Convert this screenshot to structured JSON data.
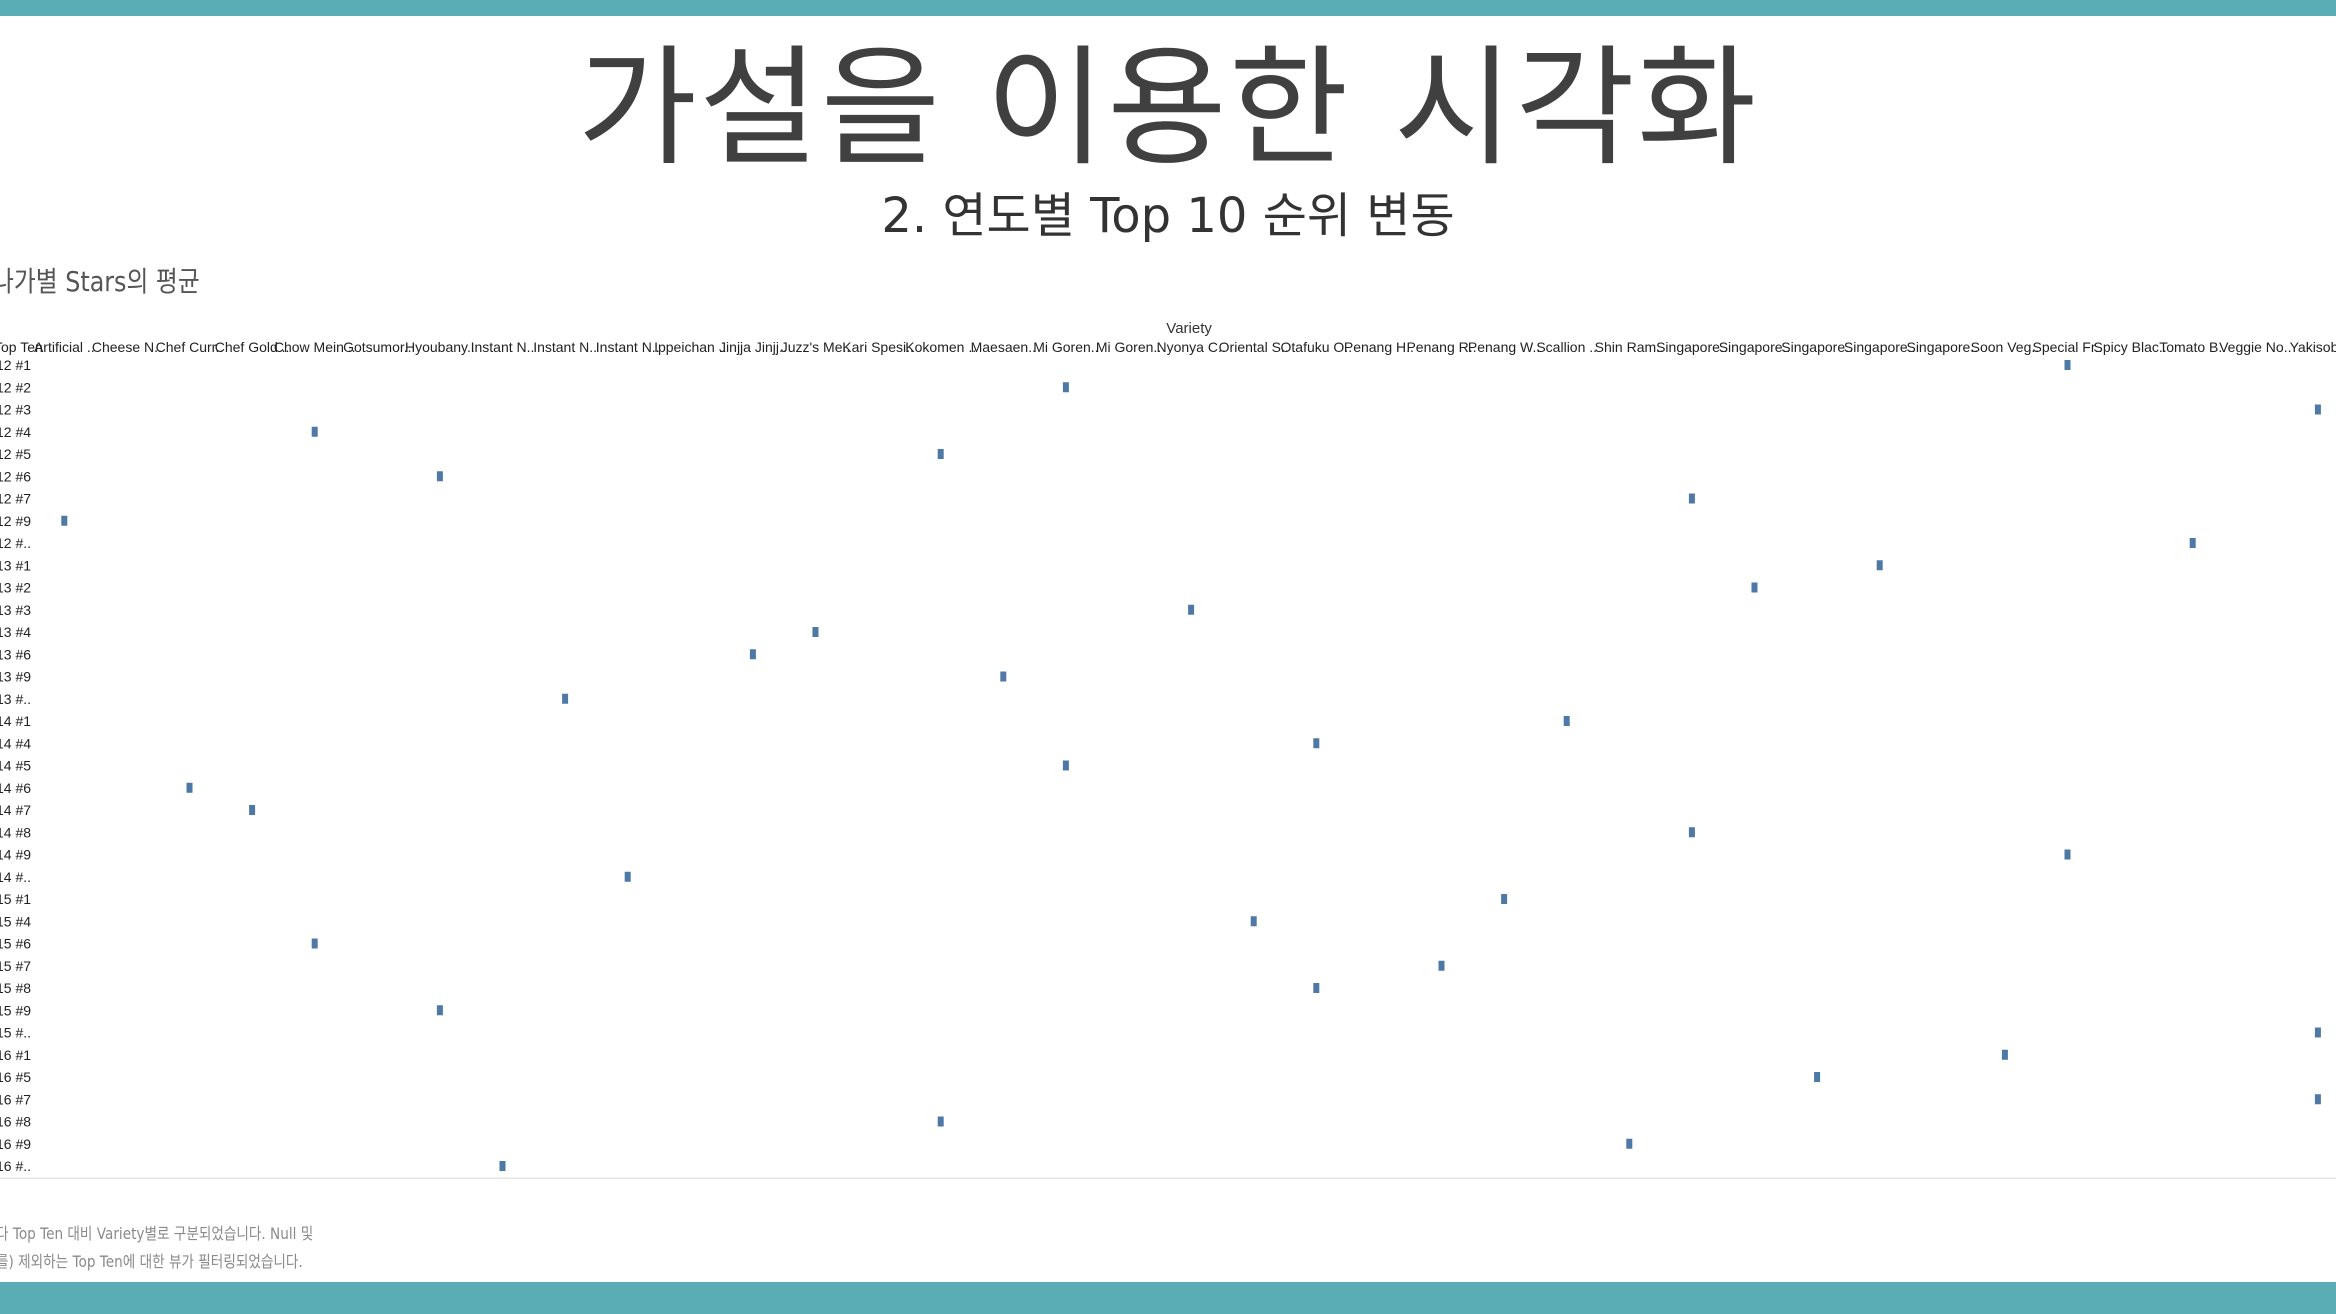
{
  "slide": {
    "title": "가설을 이용한 시각화",
    "subtitle": "2. 연도별 Top 10 순위 변동",
    "sheet_title": "나가별 Stars의 평균",
    "footnote_lines": [
      "다 Top Ten 대비 Variety별로 구분되었습니다. Null 및",
      "를) 제외하는 Top Ten에 대한 뷰가 필터링되었습니다."
    ]
  },
  "colors": {
    "accent_bar": "#5aadb5",
    "mark": "#4e79a7",
    "text": "#404040"
  },
  "chart_data": {
    "type": "scatter",
    "column_header": "Variety",
    "row_header": "Top Ten",
    "columns": [
      "Artificial ..",
      "Cheese N..",
      "Chef Curr..",
      "Chef Gold ..",
      "Chow Mein ..",
      "Gotsumor..",
      "Hyoubany..",
      "Instant N..",
      "Instant N..",
      "Instant N..",
      "Ippeichan ..",
      "Jinjja Jinjj..",
      "Juzz's Me..",
      "Kari Spesi..",
      "Kokomen ..",
      "Maesaen..",
      "Mi Goren..",
      "Mi Goren..",
      "Nyonya C..",
      "Oriental S..",
      "Otafuku O..",
      "Penang H..",
      "Penang R..",
      "Penang W..",
      "Scallion ..",
      "Shin Ram..",
      "Singapore..",
      "Singapore..",
      "Singapore..",
      "Singapore..",
      "Singapore..",
      "Soon Veg..",
      "Special Fr..",
      "Spicy Blac..",
      "Tomato B..",
      "Veggie No..",
      "Yakisoba"
    ],
    "rows": [
      "12 #1",
      "12 #2",
      "12 #3",
      "12 #4",
      "12 #5",
      "12 #6",
      "12 #7",
      "12 #9",
      "12 #..",
      "13 #1",
      "13 #2",
      "13 #3",
      "13 #4",
      "13 #6",
      "13 #9",
      "13 #..",
      "14 #1",
      "14 #4",
      "14 #5",
      "14 #6",
      "14 #7",
      "14 #8",
      "14 #9",
      "14 #..",
      "15 #1",
      "15 #4",
      "15 #6",
      "15 #7",
      "15 #8",
      "15 #9",
      "15 #..",
      "16 #1",
      "16 #5",
      "16 #7",
      "16 #8",
      "16 #9",
      "16 #.."
    ],
    "points": [
      {
        "row": "12 #1",
        "column": "Special Fr.."
      },
      {
        "row": "12 #2",
        "column": "Mi Goren.."
      },
      {
        "row": "12 #3",
        "column": "Yakisoba"
      },
      {
        "row": "12 #4",
        "column": "Chow Mein .."
      },
      {
        "row": "12 #5",
        "column": "Kokomen .."
      },
      {
        "row": "12 #6",
        "column": "Hyoubany.."
      },
      {
        "row": "12 #7",
        "column": "Singapore.."
      },
      {
        "row": "12 #9",
        "column": "Artificial .."
      },
      {
        "row": "12 #..",
        "column": "Tomato B.."
      },
      {
        "row": "13 #1",
        "column": "Singapore..",
        "column_index": 29
      },
      {
        "row": "13 #2",
        "column": "Singapore..",
        "column_index": 27
      },
      {
        "row": "13 #3",
        "column": "Nyonya C.."
      },
      {
        "row": "13 #4",
        "column": "Juzz's Me.."
      },
      {
        "row": "13 #6",
        "column": "Jinjja Jinjj.."
      },
      {
        "row": "13 #9",
        "column": "Maesaen.."
      },
      {
        "row": "13 #..",
        "column": "Instant N..",
        "column_index": 8
      },
      {
        "row": "14 #1",
        "column": "Scallion .."
      },
      {
        "row": "14 #4",
        "column": "Otafuku O.."
      },
      {
        "row": "14 #5",
        "column": "Mi Goren..",
        "column_index": 16
      },
      {
        "row": "14 #6",
        "column": "Chef Curr.."
      },
      {
        "row": "14 #7",
        "column": "Chef Gold .."
      },
      {
        "row": "14 #8",
        "column": "Singapore..",
        "column_index": 26
      },
      {
        "row": "14 #9",
        "column": "Special Fr.."
      },
      {
        "row": "14 #..",
        "column": "Instant N..",
        "column_index": 9
      },
      {
        "row": "15 #1",
        "column": "Penang W.."
      },
      {
        "row": "15 #4",
        "column": "Oriental S.."
      },
      {
        "row": "15 #6",
        "column": "Chow Mein .."
      },
      {
        "row": "15 #7",
        "column": "Penang R.."
      },
      {
        "row": "15 #8",
        "column": "Otafuku O.."
      },
      {
        "row": "15 #9",
        "column": "Hyoubany.."
      },
      {
        "row": "15 #..",
        "column": "Yakisoba"
      },
      {
        "row": "16 #1",
        "column": "Soon Veg.."
      },
      {
        "row": "16 #5",
        "column": "Singapore..",
        "column_index": 28
      },
      {
        "row": "16 #7",
        "column": "Yakisoba"
      },
      {
        "row": "16 #8",
        "column": "Kokomen .."
      },
      {
        "row": "16 #9",
        "column": "Shin Ram.."
      },
      {
        "row": "16 #..",
        "column": "Instant N..",
        "column_index": 7
      }
    ]
  }
}
